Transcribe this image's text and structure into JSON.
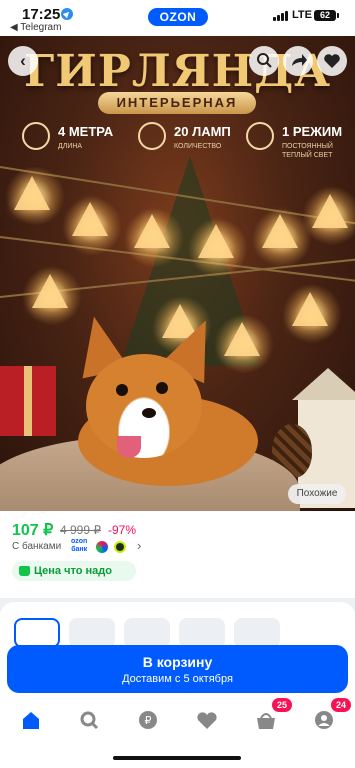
{
  "status_bar": {
    "time": "17:25",
    "back_app": "◀ Telegram",
    "brand": "OZON",
    "network": "LTE",
    "battery": "62"
  },
  "hero": {
    "title": "ГИРЛЯНДА",
    "subtitle": "ИНТЕРЬЕРНАЯ",
    "features": [
      {
        "value": "4 МЕТРА",
        "caption": "ДЛИНА",
        "icon": "ruler-icon"
      },
      {
        "value": "20 ЛАМП",
        "caption": "КОЛИЧЕСТВО",
        "icon": "lightbulb-icon"
      },
      {
        "value": "1 РЕЖИМ",
        "caption": "ПОСТОЯННЫЙ\nТЕПЛЫЙ СВЕТ",
        "icon": "gear-icon"
      }
    ],
    "similar_label": "Похожие"
  },
  "price": {
    "current": "107 ₽",
    "old": "4 999 ₽",
    "discount": "-97%",
    "banks_label": "С банками",
    "ozon_bank": "ozon\nбанк",
    "good_price": "Цена что надо"
  },
  "cart": {
    "label": "В корзину",
    "delivery": "Доставим с 5 октября"
  },
  "tabbar": {
    "cart_badge": "25",
    "profile_badge": "24"
  },
  "colors": {
    "accent": "#005bff",
    "price_green": "#10c44c",
    "discount_red": "#f91155"
  }
}
